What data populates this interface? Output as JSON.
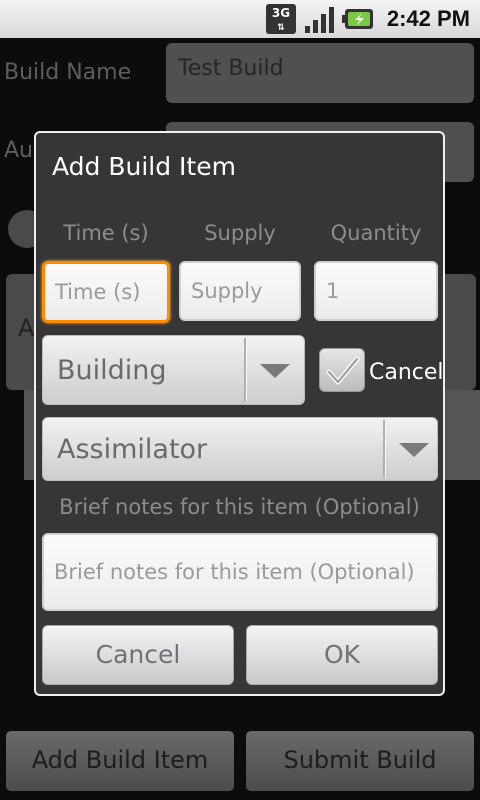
{
  "status_bar": {
    "network_label": "3G",
    "network_arrows": "⇅",
    "time": "2:42 PM"
  },
  "background_form": {
    "build_name_label": "Build Name",
    "build_name_value": "Test Build",
    "author_label_partial": "Au",
    "row_partial": "A",
    "add_build_item_label": "Add Build Item",
    "submit_build_label": "Submit Build"
  },
  "dialog": {
    "title": "Add Build Item",
    "columns": {
      "time_label": "Time (s)",
      "supply_label": "Supply",
      "quantity_label": "Quantity"
    },
    "inputs": {
      "time_placeholder": "Time (s)",
      "supply_placeholder": "Supply",
      "quantity_value": "1"
    },
    "type_spinner_value": "Building",
    "cancel_checkbox_label": "Cancel",
    "cancel_checked": true,
    "item_spinner_value": "Assimilator",
    "notes_label": "Brief notes for this item (Optional)",
    "notes_placeholder": "Brief notes for this item (Optional)",
    "cancel_button_label": "Cancel",
    "ok_button_label": "OK"
  },
  "colors": {
    "focus_accent": "#ff8c00",
    "dialog_background": "#363636"
  },
  "icons": [
    "3g-data-icon",
    "signal-strength-icon",
    "battery-charging-icon",
    "spinner-dropdown-icon",
    "checkmark-icon"
  ]
}
